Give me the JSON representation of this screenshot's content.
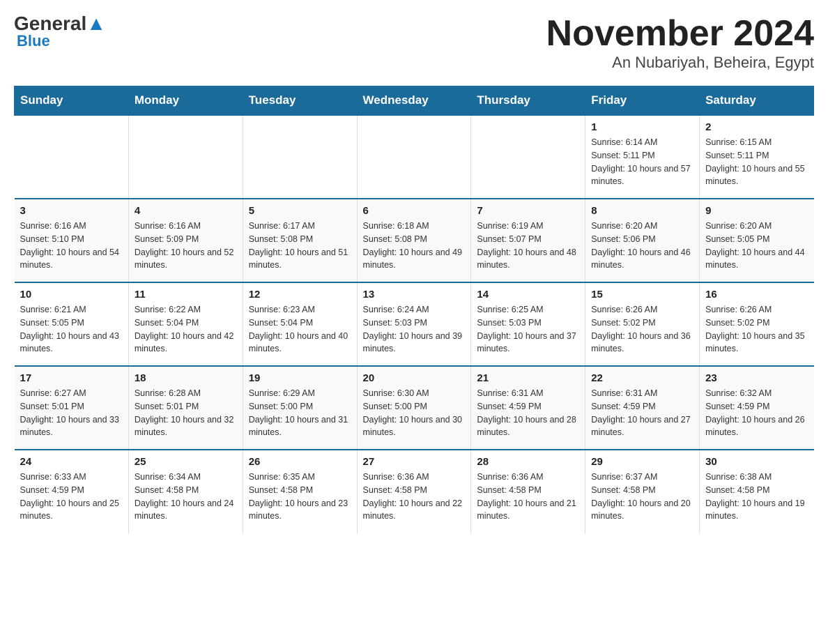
{
  "header": {
    "logo_top": "General",
    "logo_bottom": "Blue",
    "title": "November 2024",
    "subtitle": "An Nubariyah, Beheira, Egypt"
  },
  "weekdays": [
    "Sunday",
    "Monday",
    "Tuesday",
    "Wednesday",
    "Thursday",
    "Friday",
    "Saturday"
  ],
  "weeks": [
    [
      {
        "day": "",
        "info": ""
      },
      {
        "day": "",
        "info": ""
      },
      {
        "day": "",
        "info": ""
      },
      {
        "day": "",
        "info": ""
      },
      {
        "day": "",
        "info": ""
      },
      {
        "day": "1",
        "info": "Sunrise: 6:14 AM\nSunset: 5:11 PM\nDaylight: 10 hours and 57 minutes."
      },
      {
        "day": "2",
        "info": "Sunrise: 6:15 AM\nSunset: 5:11 PM\nDaylight: 10 hours and 55 minutes."
      }
    ],
    [
      {
        "day": "3",
        "info": "Sunrise: 6:16 AM\nSunset: 5:10 PM\nDaylight: 10 hours and 54 minutes."
      },
      {
        "day": "4",
        "info": "Sunrise: 6:16 AM\nSunset: 5:09 PM\nDaylight: 10 hours and 52 minutes."
      },
      {
        "day": "5",
        "info": "Sunrise: 6:17 AM\nSunset: 5:08 PM\nDaylight: 10 hours and 51 minutes."
      },
      {
        "day": "6",
        "info": "Sunrise: 6:18 AM\nSunset: 5:08 PM\nDaylight: 10 hours and 49 minutes."
      },
      {
        "day": "7",
        "info": "Sunrise: 6:19 AM\nSunset: 5:07 PM\nDaylight: 10 hours and 48 minutes."
      },
      {
        "day": "8",
        "info": "Sunrise: 6:20 AM\nSunset: 5:06 PM\nDaylight: 10 hours and 46 minutes."
      },
      {
        "day": "9",
        "info": "Sunrise: 6:20 AM\nSunset: 5:05 PM\nDaylight: 10 hours and 44 minutes."
      }
    ],
    [
      {
        "day": "10",
        "info": "Sunrise: 6:21 AM\nSunset: 5:05 PM\nDaylight: 10 hours and 43 minutes."
      },
      {
        "day": "11",
        "info": "Sunrise: 6:22 AM\nSunset: 5:04 PM\nDaylight: 10 hours and 42 minutes."
      },
      {
        "day": "12",
        "info": "Sunrise: 6:23 AM\nSunset: 5:04 PM\nDaylight: 10 hours and 40 minutes."
      },
      {
        "day": "13",
        "info": "Sunrise: 6:24 AM\nSunset: 5:03 PM\nDaylight: 10 hours and 39 minutes."
      },
      {
        "day": "14",
        "info": "Sunrise: 6:25 AM\nSunset: 5:03 PM\nDaylight: 10 hours and 37 minutes."
      },
      {
        "day": "15",
        "info": "Sunrise: 6:26 AM\nSunset: 5:02 PM\nDaylight: 10 hours and 36 minutes."
      },
      {
        "day": "16",
        "info": "Sunrise: 6:26 AM\nSunset: 5:02 PM\nDaylight: 10 hours and 35 minutes."
      }
    ],
    [
      {
        "day": "17",
        "info": "Sunrise: 6:27 AM\nSunset: 5:01 PM\nDaylight: 10 hours and 33 minutes."
      },
      {
        "day": "18",
        "info": "Sunrise: 6:28 AM\nSunset: 5:01 PM\nDaylight: 10 hours and 32 minutes."
      },
      {
        "day": "19",
        "info": "Sunrise: 6:29 AM\nSunset: 5:00 PM\nDaylight: 10 hours and 31 minutes."
      },
      {
        "day": "20",
        "info": "Sunrise: 6:30 AM\nSunset: 5:00 PM\nDaylight: 10 hours and 30 minutes."
      },
      {
        "day": "21",
        "info": "Sunrise: 6:31 AM\nSunset: 4:59 PM\nDaylight: 10 hours and 28 minutes."
      },
      {
        "day": "22",
        "info": "Sunrise: 6:31 AM\nSunset: 4:59 PM\nDaylight: 10 hours and 27 minutes."
      },
      {
        "day": "23",
        "info": "Sunrise: 6:32 AM\nSunset: 4:59 PM\nDaylight: 10 hours and 26 minutes."
      }
    ],
    [
      {
        "day": "24",
        "info": "Sunrise: 6:33 AM\nSunset: 4:59 PM\nDaylight: 10 hours and 25 minutes."
      },
      {
        "day": "25",
        "info": "Sunrise: 6:34 AM\nSunset: 4:58 PM\nDaylight: 10 hours and 24 minutes."
      },
      {
        "day": "26",
        "info": "Sunrise: 6:35 AM\nSunset: 4:58 PM\nDaylight: 10 hours and 23 minutes."
      },
      {
        "day": "27",
        "info": "Sunrise: 6:36 AM\nSunset: 4:58 PM\nDaylight: 10 hours and 22 minutes."
      },
      {
        "day": "28",
        "info": "Sunrise: 6:36 AM\nSunset: 4:58 PM\nDaylight: 10 hours and 21 minutes."
      },
      {
        "day": "29",
        "info": "Sunrise: 6:37 AM\nSunset: 4:58 PM\nDaylight: 10 hours and 20 minutes."
      },
      {
        "day": "30",
        "info": "Sunrise: 6:38 AM\nSunset: 4:58 PM\nDaylight: 10 hours and 19 minutes."
      }
    ]
  ]
}
